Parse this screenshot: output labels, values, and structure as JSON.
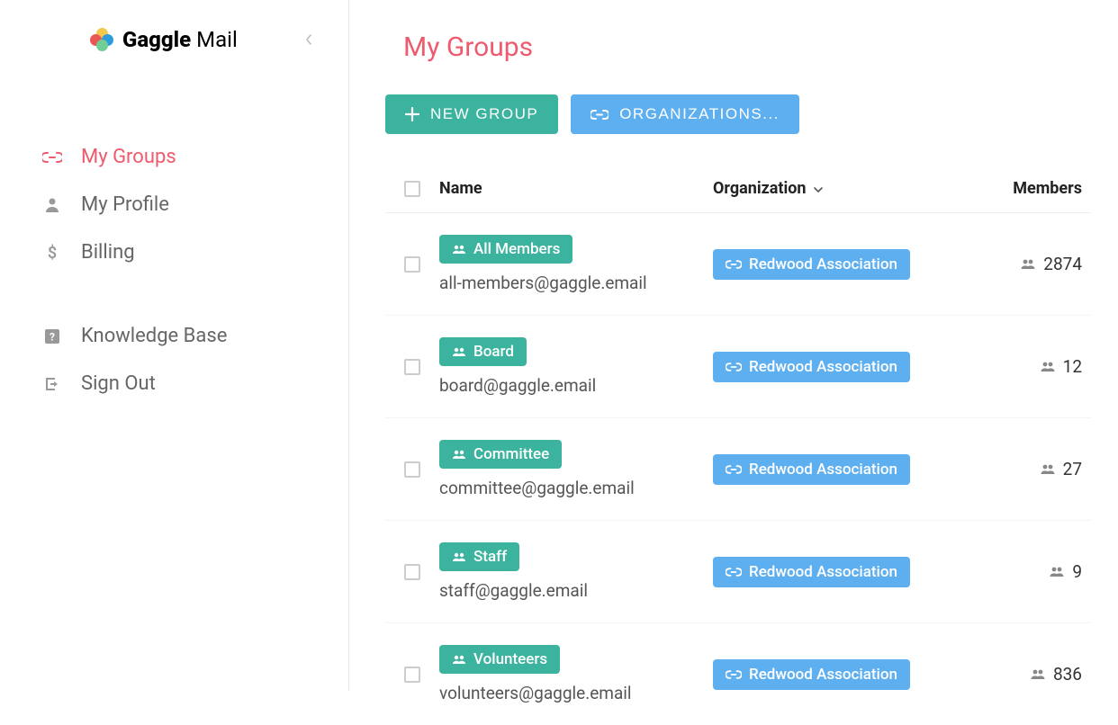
{
  "brand": {
    "bold": "Gaggle",
    "light": " Mail"
  },
  "sidebar": {
    "items": [
      {
        "label": "My Groups"
      },
      {
        "label": "My Profile"
      },
      {
        "label": "Billing"
      }
    ],
    "secondary": [
      {
        "label": "Knowledge Base"
      },
      {
        "label": "Sign Out"
      }
    ]
  },
  "page": {
    "title": "My Groups",
    "new_group_label": "NEW GROUP",
    "organizations_label": "ORGANIZATIONS..."
  },
  "table": {
    "headers": {
      "name": "Name",
      "organization": "Organization",
      "members": "Members"
    },
    "rows": [
      {
        "name": "All Members",
        "email": "all-members@gaggle.email",
        "organization": "Redwood Association",
        "members": "2874"
      },
      {
        "name": "Board",
        "email": "board@gaggle.email",
        "organization": "Redwood Association",
        "members": "12"
      },
      {
        "name": "Committee",
        "email": "committee@gaggle.email",
        "organization": "Redwood Association",
        "members": "27"
      },
      {
        "name": "Staff",
        "email": "staff@gaggle.email",
        "organization": "Redwood Association",
        "members": "9"
      },
      {
        "name": "Volunteers",
        "email": "volunteers@gaggle.email",
        "organization": "Redwood Association",
        "members": "836"
      }
    ]
  }
}
